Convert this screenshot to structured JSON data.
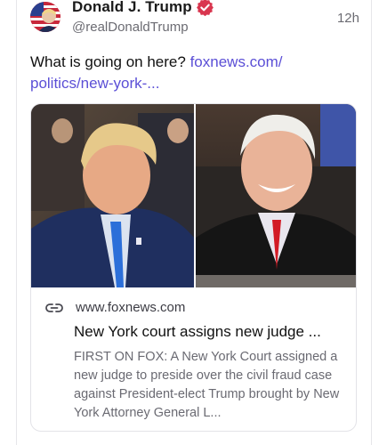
{
  "post": {
    "author": {
      "display_name": "Donald J. Trump",
      "handle": "@realDonaldTrump",
      "verified": true,
      "avatar_icon": "avatar-flag-portrait"
    },
    "time": "12h",
    "text": "What is going on here?",
    "link_text": "foxnews.com/ politics/new-york-..."
  },
  "card": {
    "domain": "www.foxnews.com",
    "title": "New York court assigns new judge ...",
    "description": "FIRST ON FOX: A New York Court assigned a new judge to preside over the civil fraud case against President-elect Trump brought by New York Attorney General L...",
    "link_icon": "link-icon"
  },
  "colors": {
    "link": "#5b4fd6",
    "verified_badge": "#d9364f",
    "muted_text": "#6b6b72"
  }
}
